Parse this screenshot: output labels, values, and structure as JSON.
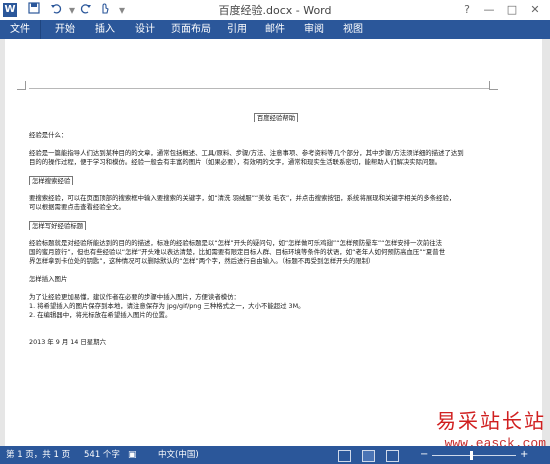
{
  "app": {
    "title": "百度经验.docx - Word",
    "logo_letter": "W",
    "window_controls": [
      "?",
      "—",
      "□",
      "✕"
    ]
  },
  "quick_access": [
    {
      "icon": "save-icon",
      "glyph": "💾"
    },
    {
      "icon": "undo-icon",
      "glyph": "↶"
    },
    {
      "icon": "redo-icon",
      "glyph": "↷"
    },
    {
      "icon": "touch-mode-icon",
      "glyph": "✋"
    },
    {
      "icon": "customize-qat-icon",
      "glyph": "▾"
    }
  ],
  "ribbon_tabs": [
    "文件",
    "开始",
    "插入",
    "设计",
    "页面布局",
    "引用",
    "邮件",
    "审阅",
    "视图"
  ],
  "document": {
    "heading": "百度经验帮助",
    "lines": [
      {
        "text": "经验是什么：",
        "type": "line"
      },
      {
        "type": "gap"
      },
      {
        "text": "经验是一篇能指导人们达到某种目的的文章，通常包括概述、工具/原料、步骤/方法、注意事项、参考资料等几个部分，其中步骤/方法须详细的描述了达到",
        "type": "line"
      },
      {
        "text": "目的的操作过程，便于学习和模仿。经验一般会有丰富的图片（如果必要），有效明的文字，通常和现实生活联系密切，能帮助人们解决实际问题。",
        "type": "line"
      },
      {
        "type": "gap"
      },
      {
        "text": "怎样搜索经验",
        "type": "box"
      },
      {
        "type": "gap"
      },
      {
        "text": "要搜索经验，可以在页面顶部的搜索框中输入要搜索的关键字，如“清洗 羽绒服”“美妆 毛衣”，并点击搜索按钮，系统将展现和关键字相关的多条经验，",
        "type": "line"
      },
      {
        "text": "可以根据需要点击查看经验全文。",
        "type": "line"
      },
      {
        "type": "gap"
      },
      {
        "text": "怎样写好经验标题",
        "type": "box"
      },
      {
        "type": "gap"
      },
      {
        "text": "经验标题就是对经验所能达到的目的的描述，标准的经验标题是以“怎样”开头的疑问句，如“怎样做可乐鸡翅”“怎样预防晕车”“怎样安排一次前往法",
        "type": "line"
      },
      {
        "text": "国的蜜月旅行”，但也有些经验以“怎样”开头难以表达清楚，比如需要有限定目标人群、目标环境等条件的状语，如“老年人如何预防高血压”“夏普世",
        "type": "line"
      },
      {
        "text": "界怎样拿到卡位处的钥匙”，这种情况可以删除默认的“怎样”两个字，然后进行自由输入。（标题不再受到怎样开头的限制）",
        "type": "line"
      },
      {
        "type": "gap"
      },
      {
        "text": "怎样插入图片",
        "type": "line"
      },
      {
        "type": "gap"
      },
      {
        "text": "为了让经验更加易懂，建议作者在必要的步骤中插入图片，方便读者模仿：",
        "type": "line"
      },
      {
        "text": "1.  将希望插入的图片保存到本地，请注意保存为 jpg/gif/png 三种格式之一，大小不能超过 3M。",
        "type": "line"
      },
      {
        "text": "2.  在编辑器中，将光标放在希望插入图片的位置。",
        "type": "line"
      },
      {
        "type": "gap"
      },
      {
        "type": "gap"
      },
      {
        "text": "2013 年 9 月 14 日星期六",
        "type": "line"
      }
    ]
  },
  "watermark": {
    "title": "易采站长站",
    "url": "www.easck.com"
  },
  "statusbar": {
    "page": "第 1 页，共 1 页",
    "words": "541 个字",
    "language": "中文(中国)"
  }
}
